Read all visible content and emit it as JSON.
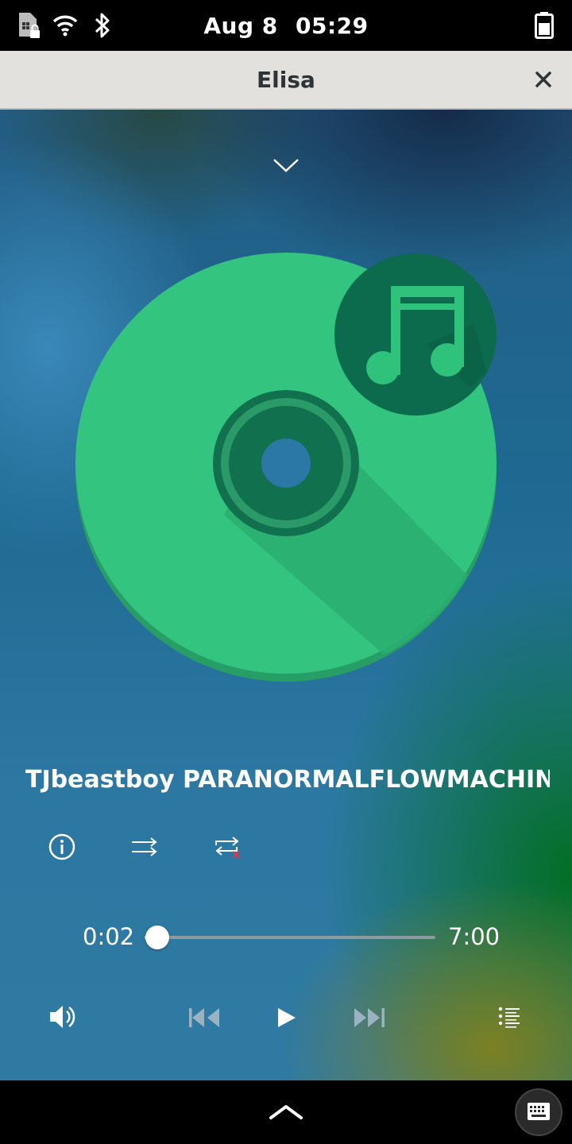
{
  "status_bar": {
    "date": "Aug 8",
    "time": "05:29",
    "icons": [
      "sim-locked-icon",
      "wifi-icon",
      "bluetooth-icon",
      "battery-icon"
    ]
  },
  "title_bar": {
    "title": "Elisa",
    "close_icon": "close-icon"
  },
  "player": {
    "track_title": "TJbeastboy PARANORMALFLOWMACHIN…",
    "elapsed": "0:02",
    "duration": "7:00",
    "progress_fraction": 0.005,
    "controls": [
      "info-icon",
      "shuffle-icon",
      "repeat-off-icon",
      "volume-icon",
      "skip-back-icon",
      "play-icon",
      "skip-forward-icon",
      "playlist-icon"
    ]
  },
  "nav_bar": {
    "icons": [
      "chevron-up-icon",
      "keyboard-icon"
    ]
  },
  "colors": {
    "disc": "#2fc27a",
    "disc_dark": "#0c6b4c",
    "titlebar": "#e3e1de"
  }
}
